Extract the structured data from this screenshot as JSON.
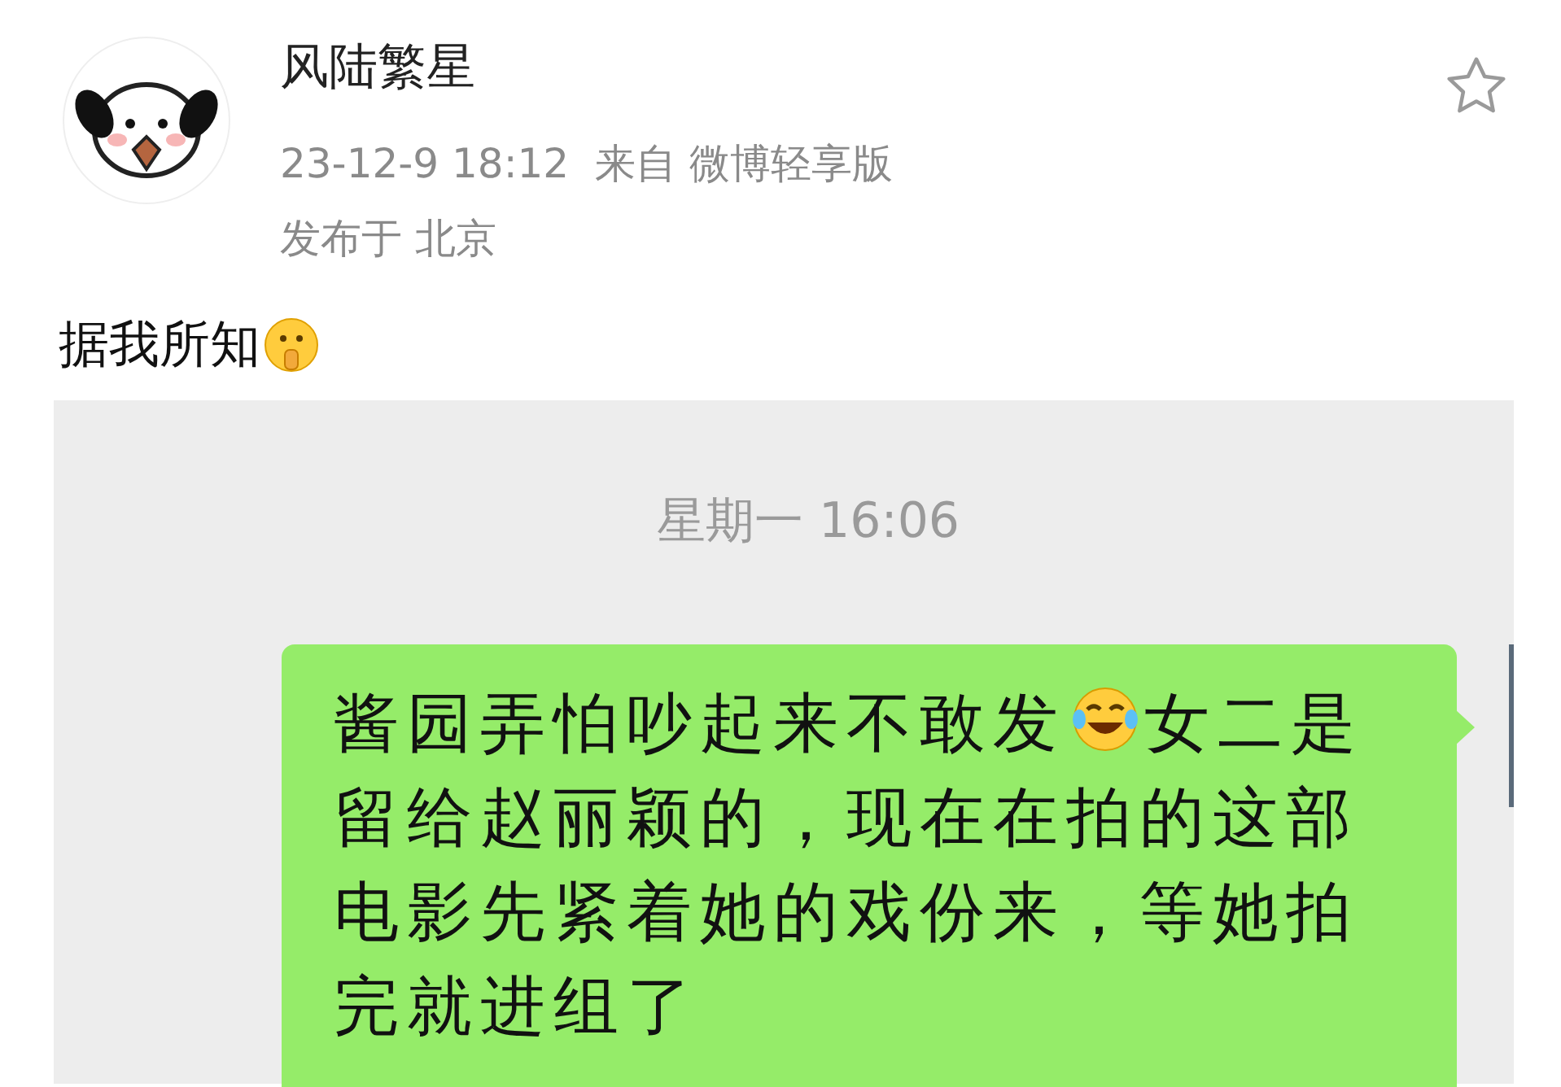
{
  "post": {
    "author": "风陆繁星",
    "time": "23-12-9 18:12",
    "source_label": "来自",
    "source": "微博轻享版",
    "location_label": "发布于",
    "location": "北京",
    "favorited": false,
    "text": "据我所知"
  },
  "chat": {
    "timestamp": "星期一 16:06",
    "message_parts": [
      {
        "kind": "text",
        "text": "酱园弄怕吵起来不敢发"
      },
      {
        "kind": "emoji"
      },
      {
        "kind": "text",
        "text": "女二是"
      },
      {
        "kind": "paragraph",
        "text": "留给赵丽颖的，现在在拍的这部电影先紧着她的戏份来，等她拍完就进组了"
      }
    ]
  }
}
